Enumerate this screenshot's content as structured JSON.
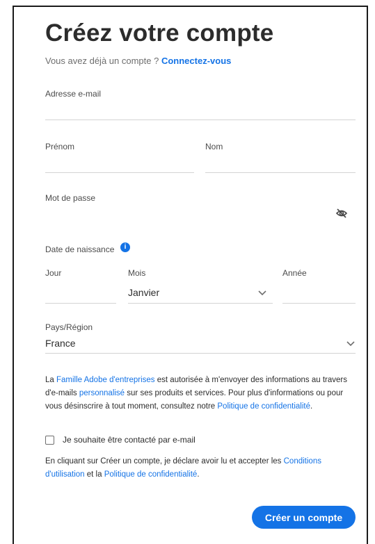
{
  "header": {
    "title": "Créez votre compte",
    "subtitle_prefix": "Vous avez déjà un compte ?",
    "signin_link": "Connectez-vous"
  },
  "form": {
    "email": {
      "label": "Adresse e-mail",
      "value": ""
    },
    "first_name": {
      "label": "Prénom",
      "value": ""
    },
    "last_name": {
      "label": "Nom",
      "value": ""
    },
    "password": {
      "label": "Mot de passe",
      "value": "",
      "toggle_icon": "eye-off-icon"
    },
    "dob": {
      "label": "Date de naissance",
      "info_icon": "info-icon",
      "day_label": "Jour",
      "month_label": "Mois",
      "month_value": "Janvier",
      "year_label": "Année"
    },
    "country": {
      "label": "Pays/Région",
      "value": "France"
    }
  },
  "consent": {
    "p1_a": "La ",
    "p1_link1": "Famille Adobe d'entreprises",
    "p1_b": " est autorisée à m'envoyer des informations au travers d'e-mails ",
    "p1_link2": "personnalisé",
    "p1_c": " sur ses produits et services. Pour plus d'informations ou pour vous désinscrire à tout moment, consultez notre ",
    "p1_link3": "Politique de confidentialité",
    "p1_d": ".",
    "checkbox_label": "Je souhaite être contacté par e-mail",
    "checked": false,
    "p2_a": "En cliquant sur Créer un compte, je déclare avoir lu et accepter les ",
    "p2_link1": "Conditions d'utilisation",
    "p2_b": " et la ",
    "p2_link2": "Politique de confidentialité",
    "p2_c": "."
  },
  "submit_label": "Créer un compte",
  "colors": {
    "accent": "#1473e6",
    "text": "#2c2c2c",
    "divider": "#d3d3d3"
  }
}
